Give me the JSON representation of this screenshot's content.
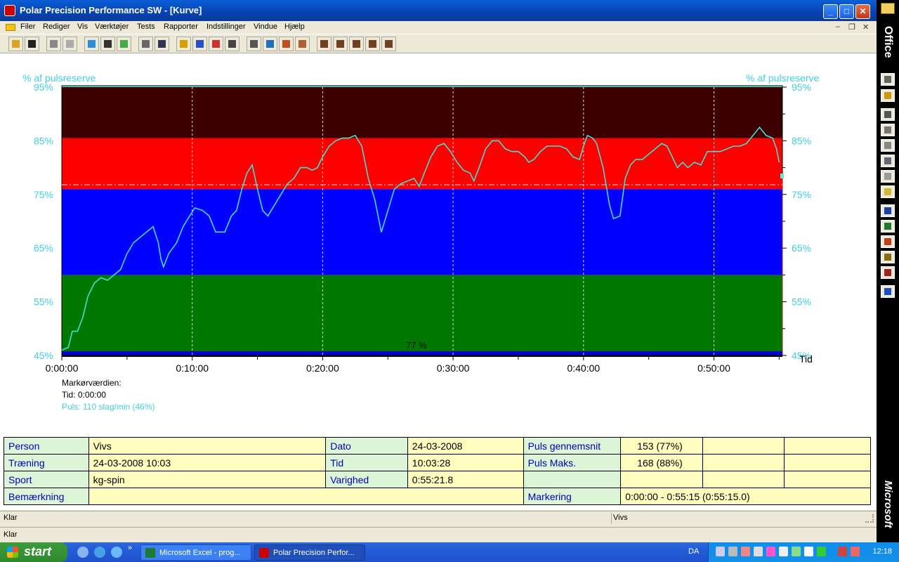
{
  "window": {
    "title": "Polar Precision Performance SW - [Kurve]",
    "controls": {
      "minimize": "_",
      "maximize": "□",
      "close": "✕"
    }
  },
  "menu": {
    "items": [
      "Filer",
      "Rediger",
      "Vis",
      "Værktøjer",
      "Tests",
      "Rapporter",
      "Indstillinger",
      "Vindue",
      "Hjælp"
    ],
    "mdi_controls": {
      "minimize": "–",
      "restore": "❐",
      "close": "✕"
    }
  },
  "toolbar": {
    "buttons": [
      "open",
      "save",
      "print",
      "copy",
      "sound",
      "transfer",
      "calendar",
      "book",
      "curve",
      "bars",
      "percent",
      "table",
      "zoom",
      "compare",
      "filter",
      "image",
      "bar-chart-1",
      "bar-chart-2",
      "bar-chart-3",
      "bar-chart-4",
      "bar-chart-5"
    ]
  },
  "chart_data": {
    "type": "line",
    "y_label_left": "% af pulsreserve",
    "y_label_right": "% af pulsreserve",
    "x_label": "Tid",
    "ylim": [
      45,
      95
    ],
    "xlim_minutes": [
      0,
      55.25
    ],
    "y_ticks": [
      "95%",
      "85%",
      "75%",
      "65%",
      "55%",
      "45%"
    ],
    "y_tick_values": [
      95,
      85,
      75,
      65,
      55,
      45
    ],
    "x_ticks": [
      "0:00:00",
      "0:10:00",
      "0:20:00",
      "0:30:00",
      "0:40:00",
      "0:50:00"
    ],
    "x_tick_values": [
      0,
      10,
      20,
      30,
      40,
      50
    ],
    "zones": [
      {
        "from": 45,
        "to": 60,
        "color": "#007800"
      },
      {
        "from": 60,
        "to": 76,
        "color": "#0000ff"
      },
      {
        "from": 76,
        "to": 85.5,
        "color": "#ff0000"
      },
      {
        "from": 85.5,
        "to": 95,
        "color": "#3c0000"
      }
    ],
    "average_line": 76.8,
    "average_label": "77 %",
    "series": [
      {
        "color": "#40e0d0",
        "points": [
          [
            0.0,
            46
          ],
          [
            0.5,
            46.5
          ],
          [
            0.8,
            49.5
          ],
          [
            1.2,
            49.5
          ],
          [
            1.6,
            52
          ],
          [
            2.0,
            56
          ],
          [
            2.5,
            58.5
          ],
          [
            3.0,
            59.5
          ],
          [
            3.5,
            59
          ],
          [
            4.0,
            60
          ],
          [
            4.5,
            61
          ],
          [
            5.0,
            64
          ],
          [
            5.5,
            66
          ],
          [
            6.0,
            67
          ],
          [
            6.5,
            68
          ],
          [
            7.0,
            69
          ],
          [
            7.4,
            66
          ],
          [
            7.6,
            63
          ],
          [
            7.8,
            61.5
          ],
          [
            8.2,
            64
          ],
          [
            8.8,
            66
          ],
          [
            9.3,
            69
          ],
          [
            9.8,
            71
          ],
          [
            10.2,
            72.5
          ],
          [
            10.8,
            72
          ],
          [
            11.3,
            71
          ],
          [
            11.8,
            68
          ],
          [
            12.5,
            68
          ],
          [
            13.0,
            71
          ],
          [
            13.4,
            72
          ],
          [
            13.8,
            76
          ],
          [
            14.2,
            79
          ],
          [
            14.6,
            80.5
          ],
          [
            15.0,
            76
          ],
          [
            15.4,
            72
          ],
          [
            15.8,
            71
          ],
          [
            16.3,
            73
          ],
          [
            16.8,
            75
          ],
          [
            17.3,
            77
          ],
          [
            17.8,
            78
          ],
          [
            18.3,
            80
          ],
          [
            18.8,
            80
          ],
          [
            19.2,
            79.5
          ],
          [
            19.6,
            80
          ],
          [
            20.0,
            82
          ],
          [
            20.5,
            84
          ],
          [
            21.0,
            85
          ],
          [
            21.5,
            85.5
          ],
          [
            22.0,
            85.5
          ],
          [
            22.5,
            86
          ],
          [
            23.0,
            84
          ],
          [
            23.5,
            78
          ],
          [
            24.0,
            74
          ],
          [
            24.5,
            68
          ],
          [
            25.0,
            72
          ],
          [
            25.5,
            76
          ],
          [
            26.0,
            77
          ],
          [
            26.5,
            77.5
          ],
          [
            27.0,
            78
          ],
          [
            27.4,
            76.5
          ],
          [
            27.8,
            79
          ],
          [
            28.3,
            82
          ],
          [
            28.8,
            84
          ],
          [
            29.3,
            84.5
          ],
          [
            29.8,
            83
          ],
          [
            30.3,
            81
          ],
          [
            30.8,
            79.5
          ],
          [
            31.3,
            79
          ],
          [
            31.6,
            77.5
          ],
          [
            32.0,
            80
          ],
          [
            32.5,
            83.5
          ],
          [
            33.0,
            85
          ],
          [
            33.5,
            85
          ],
          [
            34.0,
            83.5
          ],
          [
            34.5,
            83
          ],
          [
            35.0,
            83
          ],
          [
            35.5,
            82
          ],
          [
            35.8,
            81
          ],
          [
            36.2,
            81.5
          ],
          [
            36.7,
            83
          ],
          [
            37.2,
            84
          ],
          [
            37.7,
            84
          ],
          [
            38.2,
            84
          ],
          [
            38.7,
            83.5
          ],
          [
            39.2,
            82
          ],
          [
            39.7,
            81.5
          ],
          [
            40.0,
            84
          ],
          [
            40.3,
            86
          ],
          [
            40.7,
            85.5
          ],
          [
            41.0,
            84.5
          ],
          [
            41.5,
            80
          ],
          [
            42.0,
            73
          ],
          [
            42.3,
            70.5
          ],
          [
            42.8,
            71
          ],
          [
            43.2,
            78
          ],
          [
            43.6,
            80.5
          ],
          [
            44.0,
            81.5
          ],
          [
            44.5,
            81.5
          ],
          [
            45.0,
            82.5
          ],
          [
            45.5,
            83.5
          ],
          [
            46.0,
            84.5
          ],
          [
            46.4,
            84
          ],
          [
            46.8,
            82
          ],
          [
            47.2,
            80
          ],
          [
            47.6,
            81
          ],
          [
            48.0,
            80
          ],
          [
            48.5,
            81
          ],
          [
            49.0,
            80.5
          ],
          [
            49.5,
            83
          ],
          [
            50.0,
            83
          ],
          [
            50.5,
            83
          ],
          [
            51.0,
            83.5
          ],
          [
            51.5,
            84
          ],
          [
            52.0,
            84
          ],
          [
            52.5,
            84.5
          ],
          [
            53.0,
            86
          ],
          [
            53.5,
            87.5
          ],
          [
            54.0,
            86
          ],
          [
            54.5,
            85.5
          ],
          [
            54.8,
            83.5
          ],
          [
            55.0,
            81
          ]
        ]
      }
    ],
    "marker_time_minutes": 55.25
  },
  "cursor": {
    "heading": "Markørværdien:",
    "time": "Tid: 0:00:00",
    "pulse": "Puls: 110 slag/min (46%)"
  },
  "info_table": {
    "rows": [
      [
        "Person",
        "Vivs",
        "Dato",
        "24-03-2008",
        "Puls gennemsnit",
        "153 (77%)",
        "",
        ""
      ],
      [
        "Træning",
        "24-03-2008 10:03",
        "Tid",
        "10:03:28",
        "Puls Maks.",
        "168 (88%)",
        "",
        ""
      ],
      [
        "Sport",
        "kg-spin",
        "Varighed",
        "0:55:21.8",
        "",
        "",
        "",
        ""
      ]
    ],
    "last_row": {
      "label": "Bemærkning",
      "value": "",
      "marking_label": "Markering",
      "marking_value": "0:00:00 - 0:55:15 (0:55:15.0)"
    }
  },
  "status": {
    "left": "Klar",
    "right": "Vivs",
    "bottom": "Klar"
  },
  "office_bar": {
    "label": "Office",
    "bottom_label": "Microsoft"
  },
  "taskbar": {
    "start": "start",
    "buttons": [
      {
        "label": "Microsoft Excel - prog...",
        "active": false
      },
      {
        "label": "Polar Precision Perfor...",
        "active": true
      }
    ],
    "language": "DA",
    "clock": "12:18"
  }
}
